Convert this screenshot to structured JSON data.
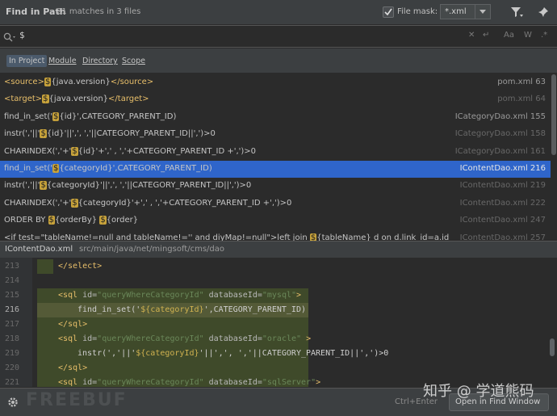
{
  "header": {
    "title": "Find in Path",
    "matches": "21 matches in 3 files",
    "file_mask_label": "File mask:",
    "file_mask_value": "*.xml",
    "file_mask_checked": true
  },
  "search": {
    "query": "$",
    "icons": [
      "search-icon",
      "clear-icon",
      "new-line-icon",
      "match-case-icon",
      "words-icon",
      "regex-icon"
    ]
  },
  "scope_tabs": [
    "In Project",
    "Module",
    "Directory",
    "Scope"
  ],
  "active_scope": "In Project",
  "results": [
    {
      "parts": [
        {
          "t": "<source>",
          "c": "tag"
        },
        {
          "t": "$",
          "c": "hl"
        },
        {
          "t": "{java.version}"
        },
        {
          "t": "</source>",
          "c": "tag"
        }
      ],
      "location": "pom.xml 63",
      "selected": false,
      "dim": false
    },
    {
      "parts": [
        {
          "t": "<target>",
          "c": "tag"
        },
        {
          "t": "$",
          "c": "hl"
        },
        {
          "t": "{java.version}"
        },
        {
          "t": "</target>",
          "c": "tag"
        }
      ],
      "location": "pom.xml 64",
      "selected": false,
      "dim": true
    },
    {
      "parts": [
        {
          "t": "find_in_set('"
        },
        {
          "t": "$",
          "c": "hl"
        },
        {
          "t": "{id}',CATEGORY_PARENT_ID)"
        }
      ],
      "location": "ICategoryDao.xml 155",
      "selected": false,
      "dim": false
    },
    {
      "parts": [
        {
          "t": "instr(','||'"
        },
        {
          "t": "$",
          "c": "hl"
        },
        {
          "t": "{id}'||',', ','||CATEGORY_PARENT_ID||',')>0"
        }
      ],
      "location": "ICategoryDao.xml 158",
      "selected": false,
      "dim": true
    },
    {
      "parts": [
        {
          "t": "CHARINDEX(','+'"
        },
        {
          "t": "$",
          "c": "hl"
        },
        {
          "t": "{id}'+',' , ','+CATEGORY_PARENT_ID +',')>0"
        }
      ],
      "location": "ICategoryDao.xml 161",
      "selected": false,
      "dim": true
    },
    {
      "parts": [
        {
          "t": "find_in_set('"
        },
        {
          "t": "$",
          "c": "hl"
        },
        {
          "t": "{categoryId}',CATEGORY_PARENT_ID)"
        }
      ],
      "location": "IContentDao.xml 216",
      "selected": true,
      "dim": false
    },
    {
      "parts": [
        {
          "t": "instr(','||'"
        },
        {
          "t": "$",
          "c": "hl"
        },
        {
          "t": "{categoryId}'||',', ','||CATEGORY_PARENT_ID||',')>0"
        }
      ],
      "location": "IContentDao.xml 219",
      "selected": false,
      "dim": true
    },
    {
      "parts": [
        {
          "t": "CHARINDEX(','+'"
        },
        {
          "t": "$",
          "c": "hl"
        },
        {
          "t": "{categoryId}'+',' , ','+CATEGORY_PARENT_ID +',')>0"
        }
      ],
      "location": "IContentDao.xml 222",
      "selected": false,
      "dim": true
    },
    {
      "parts": [
        {
          "t": "ORDER BY "
        },
        {
          "t": "$",
          "c": "hl"
        },
        {
          "t": "{orderBy} "
        },
        {
          "t": "$",
          "c": "hl"
        },
        {
          "t": "{order}"
        }
      ],
      "location": "IContentDao.xml 247",
      "selected": false,
      "dim": true
    },
    {
      "parts": [
        {
          "t": "<if test=\"tableName!=null and tableName!='' and diyMap!=null\">left join "
        },
        {
          "t": "$",
          "c": "hl"
        },
        {
          "t": "{tableName} d on d.link_id=a.id"
        }
      ],
      "location": "IContentDao.xml 257",
      "selected": false,
      "dim": true
    }
  ],
  "path_bar": {
    "file": "IContentDao.xml",
    "dir": "src/main/java/net/mingsoft/cms/dao"
  },
  "editor": {
    "current_line": "216",
    "lines": [
      {
        "n": "213",
        "parts": [
          {
            "t": "</select>",
            "c": "ctag"
          }
        ],
        "indent": "",
        "band": "partial"
      },
      {
        "n": "214",
        "parts": [],
        "indent": "",
        "band": "none"
      },
      {
        "n": "215",
        "parts": [
          {
            "t": "<sql ",
            "c": "ctag"
          },
          {
            "t": "id=",
            "c": "cattr"
          },
          {
            "t": "\"queryWhereCategoryId\"",
            "c": "cstr"
          },
          {
            "t": " databaseId=",
            "c": "cattr"
          },
          {
            "t": "\"mysql\"",
            "c": "cstr"
          },
          {
            "t": ">",
            "c": "ctag"
          }
        ],
        "indent": "",
        "band": "full"
      },
      {
        "n": "216",
        "parts": [
          {
            "t": "find_in_set('"
          },
          {
            "t": "${categoryId}",
            "c": "hlc"
          },
          {
            "t": "',CATEGORY_PARENT_ID)"
          }
        ],
        "indent": "    ",
        "band": "bright"
      },
      {
        "n": "217",
        "parts": [
          {
            "t": "</sql>",
            "c": "ctag"
          }
        ],
        "indent": "",
        "band": "full"
      },
      {
        "n": "218",
        "parts": [
          {
            "t": "<sql ",
            "c": "ctag"
          },
          {
            "t": "id=",
            "c": "cattr"
          },
          {
            "t": "\"queryWhereCategoryId\"",
            "c": "cstr"
          },
          {
            "t": " databaseId=",
            "c": "cattr"
          },
          {
            "t": "\"oracle\"",
            "c": "cstr"
          },
          {
            "t": " >",
            "c": "ctag"
          }
        ],
        "indent": "",
        "band": "full"
      },
      {
        "n": "219",
        "parts": [
          {
            "t": "instr(','||'"
          },
          {
            "t": "${categoryId}",
            "c": "hlc"
          },
          {
            "t": "'||',', ','||CATEGORY_PARENT_ID||',')>0"
          }
        ],
        "indent": "    ",
        "band": "full"
      },
      {
        "n": "220",
        "parts": [
          {
            "t": "</sql>",
            "c": "ctag"
          }
        ],
        "indent": "",
        "band": "full"
      },
      {
        "n": "221",
        "parts": [
          {
            "t": "<sql ",
            "c": "ctag"
          },
          {
            "t": "id=",
            "c": "cattr"
          },
          {
            "t": "\"queryWhereCategoryId\"",
            "c": "cstr"
          },
          {
            "t": " databaseId=",
            "c": "cattr"
          },
          {
            "t": "\"sqlServer\"",
            "c": "cstr"
          },
          {
            "t": ">",
            "c": "ctag"
          }
        ],
        "indent": "",
        "band": "full"
      }
    ]
  },
  "bottom": {
    "shortcut_hint": "Ctrl+Enter",
    "open_button": "Open in Find Window",
    "watermark_left": "FREEBUF",
    "watermark_right": "知乎 @ 学道熊码"
  }
}
